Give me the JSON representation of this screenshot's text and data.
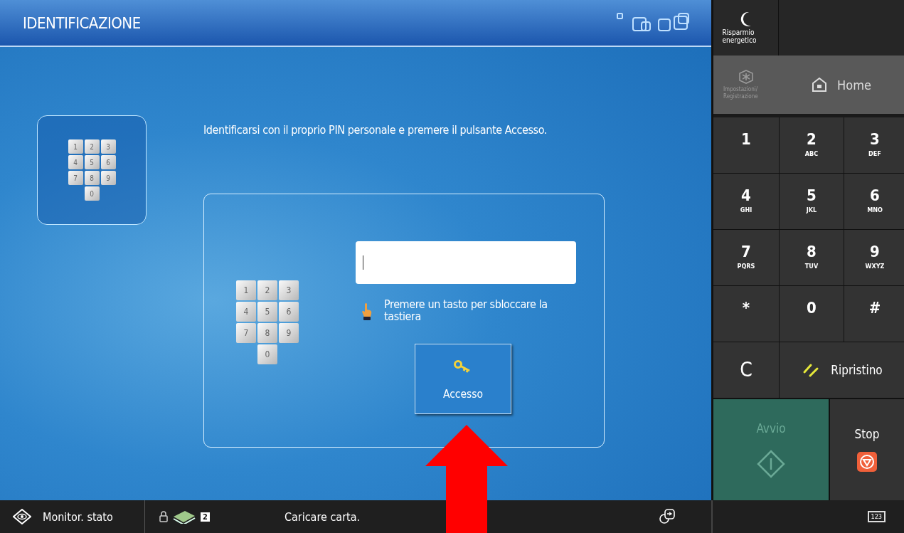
{
  "header": {
    "title": "IDENTIFICAZIONE"
  },
  "instruction": "Identificarsi con il proprio PIN personale e premere il pulsante Accesso.",
  "keypad_card": {
    "keys": [
      "1",
      "2",
      "3",
      "4",
      "5",
      "6",
      "7",
      "8",
      "9",
      "0"
    ]
  },
  "login_panel": {
    "keys": [
      "1",
      "2",
      "3",
      "4",
      "5",
      "6",
      "7",
      "8",
      "9",
      "0"
    ],
    "hint": "Premere un tasto per sbloccare la tastiera",
    "login_button": "Accesso"
  },
  "side_panel": {
    "energy_saver": "Risparmio energetico",
    "settings": {
      "label": "Impostazioni/ Registrazione",
      "disabled": true
    },
    "home": {
      "label": "Home",
      "disabled": false
    },
    "keypad": [
      {
        "digit": "1"
      },
      {
        "digit": "2",
        "letters": "ABC"
      },
      {
        "digit": "3",
        "letters": "DEF"
      },
      {
        "digit": "4",
        "letters": "GHI"
      },
      {
        "digit": "5",
        "letters": "JKL"
      },
      {
        "digit": "6",
        "letters": "MNO"
      },
      {
        "digit": "7",
        "letters": "PQRS"
      },
      {
        "digit": "8",
        "letters": "TUV"
      },
      {
        "digit": "9",
        "letters": "WXYZ"
      },
      {
        "digit": "*"
      },
      {
        "digit": "0"
      },
      {
        "digit": "#"
      }
    ],
    "clear": "C",
    "reset": "Ripristino",
    "start": {
      "label": "Avvio",
      "disabled": true
    },
    "stop": {
      "label": "Stop",
      "disabled": false
    }
  },
  "status_bar": {
    "monitor": "Monitor. stato",
    "job_count": "2",
    "message": "Caricare carta.",
    "keyboard": "123"
  }
}
